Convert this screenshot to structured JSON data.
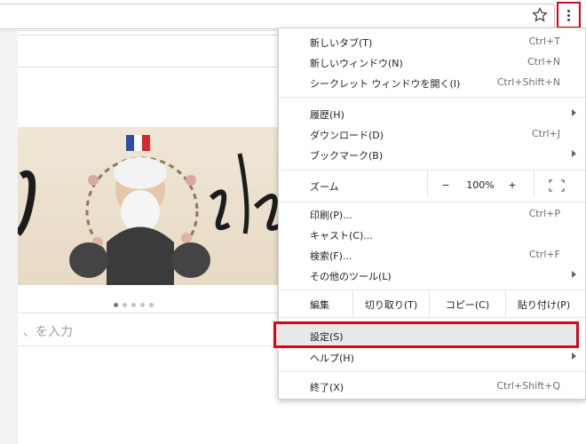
{
  "browser": {
    "search_placeholder": "、を入力"
  },
  "menu": {
    "group1": [
      {
        "label": "新しいタブ(T)",
        "shortcut": "Ctrl+T"
      },
      {
        "label": "新しいウィンドウ(N)",
        "shortcut": "Ctrl+N"
      },
      {
        "label": "シークレット ウィンドウを開く(I)",
        "shortcut": "Ctrl+Shift+N"
      }
    ],
    "group2": [
      {
        "label": "履歴(H)",
        "shortcut": ""
      },
      {
        "label": "ダウンロード(D)",
        "shortcut": "Ctrl+J"
      },
      {
        "label": "ブックマーク(B)",
        "shortcut": ""
      }
    ],
    "zoom": {
      "label": "ズーム",
      "minus": "−",
      "value": "100%",
      "plus": "+"
    },
    "group4": [
      {
        "label": "印刷(P)...",
        "shortcut": "Ctrl+P"
      },
      {
        "label": "キャスト(C)...",
        "shortcut": ""
      },
      {
        "label": "検索(F)...",
        "shortcut": "Ctrl+F"
      },
      {
        "label": "その他のツール(L)",
        "shortcut": ""
      }
    ],
    "edit": {
      "label": "編集",
      "cut": "切り取り(T)",
      "copy": "コピー(C)",
      "paste": "貼り付け(P)"
    },
    "settings": {
      "label": "設定(S)"
    },
    "help": {
      "label": "ヘルプ(H)"
    },
    "exit": {
      "label": "終了(X)",
      "shortcut": "Ctrl+Shift+Q"
    }
  }
}
